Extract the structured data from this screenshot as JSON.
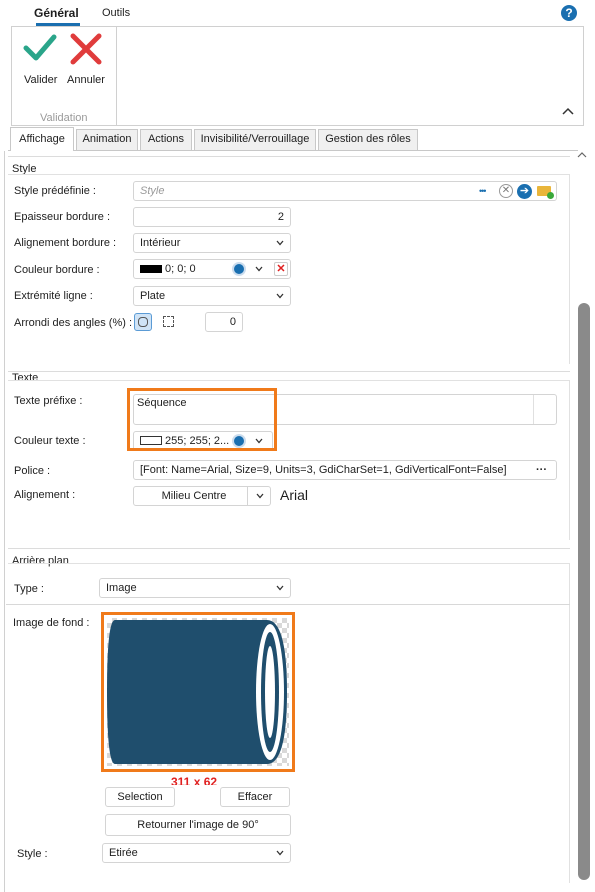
{
  "ribbon": {
    "tabs": [
      {
        "label": "Général"
      },
      {
        "label": "Outils"
      }
    ],
    "help": "?",
    "validate_label": "Valider",
    "cancel_label": "Annuler",
    "group_label": "Validation"
  },
  "tabs": [
    {
      "label": "Affichage"
    },
    {
      "label": "Animation"
    },
    {
      "label": "Actions"
    },
    {
      "label": "Invisibilité/Verrouillage"
    },
    {
      "label": "Gestion des rôles"
    }
  ],
  "style": {
    "title": "Style",
    "predefined_label": "Style prédéfinie :",
    "predefined_placeholder": "Style",
    "ellipsis": "•••",
    "border_width_label": "Epaisseur bordure :",
    "border_width_value": "2",
    "border_align_label": "Alignement bordure :",
    "border_align_value": "Intérieur",
    "border_color_label": "Couleur bordure :",
    "border_color_value": "0; 0; 0",
    "border_color_hex": "#000000",
    "line_end_label": "Extrémité ligne :",
    "line_end_value": "Plate",
    "corner_label": "Arrondi des angles (%) :",
    "corner_value": "0"
  },
  "text": {
    "title": "Texte",
    "prefix_label": "Texte préfixe :",
    "prefix_value": "Séquence",
    "color_label": "Couleur texte :",
    "color_value": "255; 255; 2...",
    "color_hex": "#ffffff",
    "font_label": "Police :",
    "font_value": "[Font: Name=Arial, Size=9, Units=3, GdiCharSet=1, GdiVerticalFont=False]",
    "font_ellipsis": "···",
    "align_label": "Alignement :",
    "align_value": "Milieu Centre",
    "font_preview": "Arial"
  },
  "background": {
    "title": "Arrière plan",
    "type_label": "Type :",
    "type_value": "Image",
    "image_label": "Image de fond :",
    "image_size": "311 x 62",
    "selection_label": "Selection",
    "clear_label": "Effacer",
    "rotate_label": "Retourner l'image de 90°",
    "style_label": "Style :",
    "style_value": "Etirée",
    "image_color": "#1f4e6d"
  },
  "colors": {
    "accent": "#f07a1a",
    "link": "#1a6fb0",
    "error": "#e02020"
  }
}
